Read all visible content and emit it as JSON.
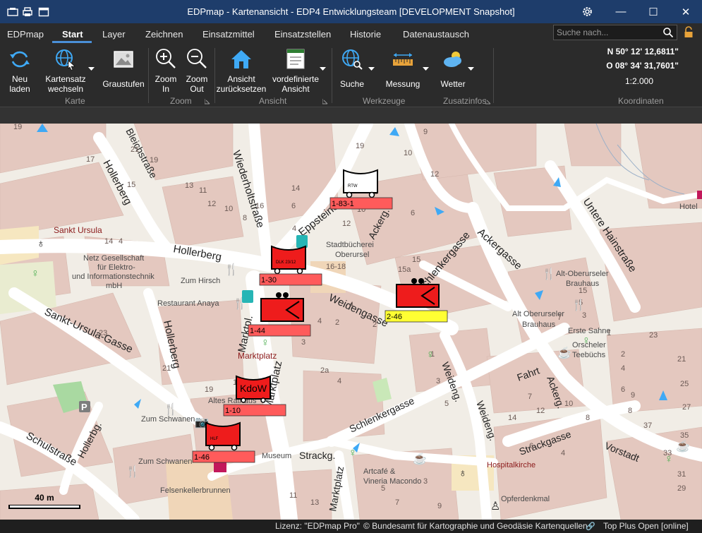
{
  "window": {
    "title": "EDPmap - Kartenansicht - EDP4 Entwicklungsteam  [DEVELOPMENT Snapshot]",
    "minimize": "—",
    "maximize": "☐",
    "close": "✕"
  },
  "menu": {
    "items": [
      "EDPmap",
      "Start",
      "Layer",
      "Zeichnen",
      "Einsatzmittel",
      "Einsatzstellen",
      "Historie",
      "Datenaustausch"
    ],
    "active": "Start",
    "search_placeholder": "Suche nach..."
  },
  "ribbon": {
    "reload": [
      "Neu",
      "laden"
    ],
    "map_switch": [
      "Kartensatz",
      "wechseln"
    ],
    "grayscale": "Graustufen",
    "zoom_in": [
      "Zoom",
      "In"
    ],
    "zoom_out": [
      "Zoom",
      "Out"
    ],
    "reset_view": [
      "Ansicht",
      "zurücksetzen"
    ],
    "predefined_view": [
      "vordefinierte",
      "Ansicht"
    ],
    "search": "Suche",
    "measure": "Messung",
    "weather": "Wetter",
    "groups": {
      "karte": "Karte",
      "zoom": "Zoom",
      "ansicht": "Ansicht",
      "werkzeuge": "Werkzeuge",
      "zusatzinfos": "Zusatzinfos",
      "koordinaten": "Koordinaten"
    },
    "coordinates": {
      "north": "N 50° 12' 12,6811\"",
      "east": "O 08° 34' 31,7601\"",
      "scale": "1:2.000"
    }
  },
  "map": {
    "street_labels": [
      "Bleichstraße",
      "Hollerberg",
      "Wiederholtstraße",
      "Eppsteiner",
      "Ackerg.",
      "Untere Hainstraße",
      "Hollerberg",
      "Weidengasse",
      "Schlenkergasse",
      "Ackergasse",
      "Sankt-Ursula-Gasse",
      "Hollerberg",
      "Marktpl.",
      "Marktplatz",
      "Weideng.",
      "Weideng.",
      "Fahrt",
      "Ackerg.",
      "Schlenkergasse",
      "Strackgasse",
      "Vorstadt",
      "Schulstraße",
      "Hollerbg.",
      "Strackg.",
      "Marktplatz"
    ],
    "poi_labels": [
      "Sankt Ursula",
      "Netz Gesellschaft",
      "für Elektro-",
      "und Informationstechnik",
      "mbH",
      "Zum Hirsch",
      "Restaurant Anaya",
      "Stadtbücherei",
      "Oberursel",
      "Alt-Oberurseler",
      "Brauhaus",
      "Alt Oberurseler",
      "Brauhaus",
      "Erste Sahne",
      "Orscheler",
      "Teebüchs",
      "Altes Rathaus",
      "Zum Schwanen",
      "Zum Schwanen",
      "Museum",
      "Hospitalkirche",
      "Artcafé &",
      "Vineria Macondo",
      "Opferdenkmal",
      "Felsenkellerbrunnen",
      "Hotel"
    ],
    "house_numbers": [
      "19",
      "21",
      "17",
      "19",
      "15",
      "14",
      "4",
      "13",
      "11",
      "12",
      "10",
      "8",
      "16",
      "14",
      "6",
      "4",
      "12",
      "19",
      "16-18",
      "15a",
      "15",
      "10",
      "9",
      "12",
      "10",
      "8",
      "6",
      "3",
      "4",
      "1",
      "2",
      "4",
      "2a",
      "2",
      "4",
      "1",
      "3",
      "5",
      "7",
      "9",
      "37",
      "35",
      "33",
      "31",
      "29",
      "27",
      "25",
      "21",
      "23",
      "15",
      "7",
      "5",
      "3",
      "1",
      "2",
      "4",
      "6",
      "8",
      "14",
      "12",
      "10",
      "8",
      "6",
      "4",
      "3",
      "5",
      "7",
      "9",
      "11",
      "13",
      "15",
      "17",
      "19",
      "21",
      "23"
    ],
    "scale_bar": "40 m",
    "units": [
      {
        "label": "1-83-1",
        "tag": "RTW",
        "color": "#ff5b5b"
      },
      {
        "label": "1-30",
        "tag": "DLK 23/12",
        "color": "#ff5b5b"
      },
      {
        "label": "1-44",
        "tag": "",
        "color": "#ff5b5b"
      },
      {
        "label": "2-46",
        "tag": "",
        "color": "#ffff33"
      },
      {
        "label": "1-10",
        "tag": "KdoW",
        "color": "#ff5b5b"
      },
      {
        "label": "1-46",
        "tag": "HLF",
        "color": "#ff5b5b"
      }
    ]
  },
  "status": {
    "license": "Lizenz: \"EDPmap Pro\"",
    "attribution": "© Bundesamt für Kartographie und Geodäsie Kartenquellen",
    "source": "Top Plus Open [online]"
  }
}
